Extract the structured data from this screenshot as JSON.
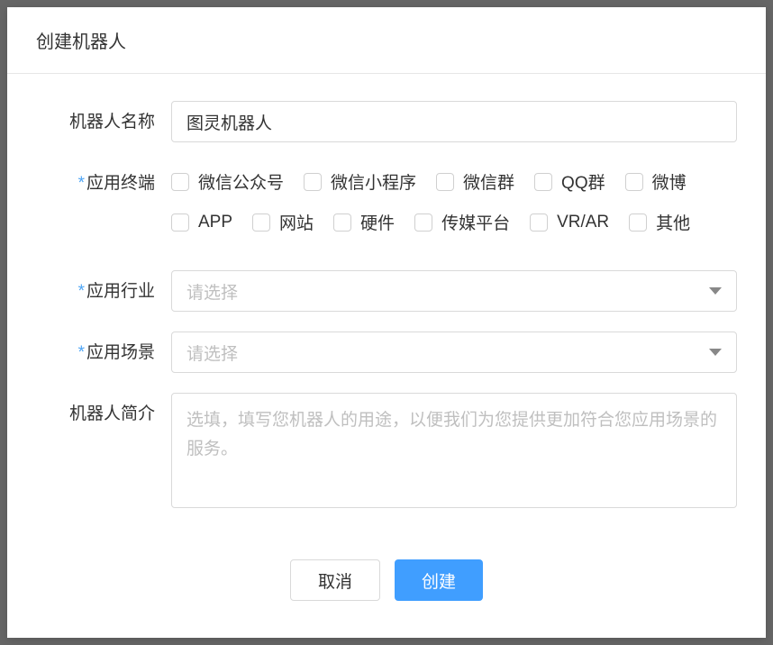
{
  "modal": {
    "title": "创建机器人"
  },
  "form": {
    "name": {
      "label": "机器人名称",
      "value": "图灵机器人"
    },
    "terminal": {
      "label": "应用终端",
      "options": [
        "微信公众号",
        "微信小程序",
        "微信群",
        "QQ群",
        "微博",
        "APP",
        "网站",
        "硬件",
        "传媒平台",
        "VR/AR",
        "其他"
      ]
    },
    "industry": {
      "label": "应用行业",
      "placeholder": "请选择"
    },
    "scenario": {
      "label": "应用场景",
      "placeholder": "请选择"
    },
    "description": {
      "label": "机器人简介",
      "placeholder": "选填，填写您机器人的用途，以便我们为您提供更加符合您应用场景的服务。"
    }
  },
  "buttons": {
    "cancel": "取消",
    "create": "创建"
  }
}
